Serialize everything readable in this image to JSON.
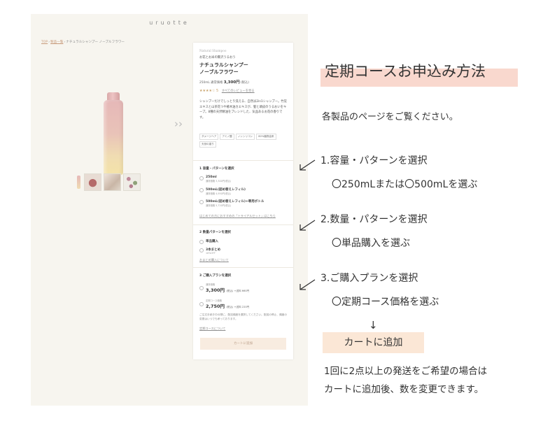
{
  "site": {
    "logo": "uruotte",
    "breadcrumb": {
      "top": "TOP",
      "products": "製品一覧",
      "current": "ナチュラルシャンプー ノーブルフラワー"
    },
    "thumbnails": [
      "bottle-thumbnail",
      "model-photo",
      "hair-photo",
      "flower-photo"
    ],
    "product": {
      "brand_en": "Natural Shampoo",
      "catch": "お花とお米の贅沢うるおう",
      "name_line1": "ナチュラルシャンプー",
      "name_line2": "ノーブルフラワー",
      "price_prefix": "250mL 通常価格",
      "price": "3,300円",
      "price_suffix": "(税込)",
      "stars": "★★★★☆",
      "review_count": "5",
      "review_link": "すべてのレビューを見る",
      "description": "シャンプーだけでしっとり洗える、自然派2in1シャンプー。竹炭エキスと山茶花つや椿木油カエキスが、髪と頭皮のうるおいをキープ。8種の天然精油をブレンドした、気品あるお花の香りです。",
      "tags": [
        "ダメージヘア",
        "アミノ酸",
        "ノンシリコン",
        "80%植物由来",
        "天然の香り"
      ]
    },
    "section1": {
      "title": "1 容量・パターンを選択",
      "options": [
        {
          "main": "250ml",
          "sub": "通常価格 3,300円(税込)"
        },
        {
          "main": "500mL(詰め替えレフィル)",
          "sub": "通常価格 4,950円(税込)"
        },
        {
          "main": "500mL(詰め替えレフィル)+専用ボトル",
          "sub": "通常価格 5,720円(税込)"
        }
      ],
      "link": "はじめての方におすすめの「トライアルセット」はこちら"
    },
    "section2": {
      "title": "2 数量パターンを選択",
      "options": [
        {
          "main": "単品購入",
          "sub": ""
        },
        {
          "main": "3本まとめ",
          "sub": "10%OFF"
        }
      ],
      "link": "おまとめ購入について"
    },
    "section3": {
      "title": "3 ご購入プランを選択",
      "options": [
        {
          "label": "通常価格",
          "price": "3,300円",
          "suffix": "(税込) +送料 660円"
        },
        {
          "label": "定期コース価格",
          "price": "2,750円",
          "suffix": "(税込) +送料 220円"
        }
      ],
      "note": "ご注文手続き中の際に、配送頻度を選択してください。配送の停止、頻度の変更はいつでも承っております。",
      "link": "定期コースについて",
      "cart_button": "カートに追加"
    }
  },
  "guide": {
    "title": "定期コースお申込み方法",
    "intro": "各製品のページをご覧ください。",
    "steps": [
      {
        "label": "1.容量・パターンを選択",
        "detail": "〇250mLまたは〇500mLを選ぶ"
      },
      {
        "label": "2.数量・パターンを選択",
        "detail": "〇単品購入を選ぶ"
      },
      {
        "label": "3.ご購入プランを選択",
        "detail": "〇定期コース価格を選ぶ"
      }
    ],
    "down_arrow": "↓",
    "cart_label": "カートに追加",
    "footnote_line1": "1回に2点以上の発送をご希望の場合は",
    "footnote_line2": "カートに追加後、数を変更できます。"
  }
}
